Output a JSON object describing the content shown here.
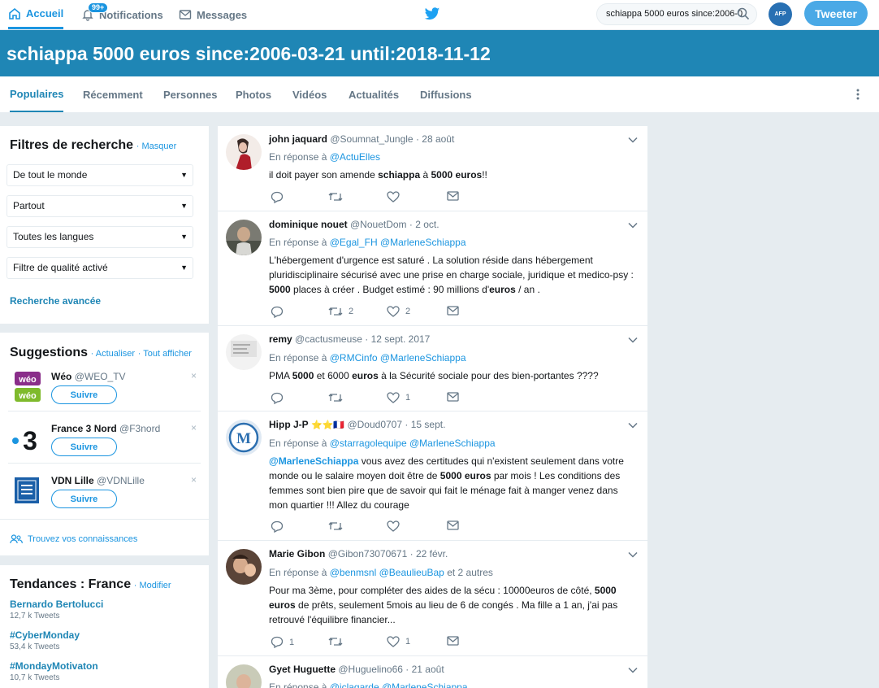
{
  "nav": {
    "home": "Accueil",
    "notifications": "Notifications",
    "notif_badge": "99+",
    "messages": "Messages",
    "search_value": "schiappa 5000 euros since:2006-0",
    "avatar_text": "AFP",
    "tweet_button": "Tweeter"
  },
  "banner": {
    "title": "schiappa 5000 euros since:2006-03-21 until:2018-11-12"
  },
  "tabs": [
    "Populaires",
    "Récemment",
    "Personnes",
    "Photos",
    "Vidéos",
    "Actualités",
    "Diffusions"
  ],
  "filters": {
    "title": "Filtres de recherche",
    "hide": "Masquer",
    "selects": [
      "De tout le monde",
      "Partout",
      "Toutes les langues",
      "Filtre de qualité activé"
    ],
    "advanced": "Recherche avancée"
  },
  "suggestions": {
    "title": "Suggestions",
    "refresh": "Actualiser",
    "show_all": "Tout afficher",
    "follow_label": "Suivre",
    "close": "×",
    "items": [
      {
        "name": "Wéo",
        "handle": "@WEO_TV"
      },
      {
        "name": "France 3 Nord",
        "handle": "@F3nord"
      },
      {
        "name": "VDN Lille",
        "handle": "@VDNLille"
      }
    ],
    "find_people": "Trouvez vos connaissances"
  },
  "trends": {
    "title": "Tendances : France",
    "edit": "Modifier",
    "items": [
      {
        "name": "Bernardo Bertolucci",
        "count": "12,7 k Tweets"
      },
      {
        "name": "#CyberMonday",
        "count": "53,4 k Tweets"
      },
      {
        "name": "#MondayMotivaton",
        "count": "10,7 k Tweets"
      }
    ]
  },
  "tweets": [
    {
      "name": "john jaquard",
      "handle": "@Soumnat_Jungle",
      "sep": "·",
      "date": "28 août",
      "reply_prefix": "En réponse à",
      "reply_to": "@ActuElles",
      "body": [
        "il doit payer son amende ",
        "schiappa",
        " à ",
        "5000",
        " ",
        "euros",
        "!!"
      ],
      "retweets": "",
      "likes": ""
    },
    {
      "name": "dominique nouet",
      "handle": "@NouetDom",
      "sep": "·",
      "date": "2 oct.",
      "reply_prefix": "En réponse à",
      "reply_to": "@Egal_FH @MarleneSchiappa",
      "body_1": "L'hébergement d'urgence est saturé . La solution réside dans hébergement pluridisciplinaire sécurisé avec une prise en charge sociale, juridique et medico-psy : ",
      "body_b1": "5000",
      "body_2": " places à créer . Budget estimé : 90 millions d'",
      "body_b2": "euros",
      "body_3": " / an .",
      "retweets": "2",
      "likes": "2"
    },
    {
      "name": "remy",
      "handle": "@cactusmeuse",
      "sep": "·",
      "date": "12 sept. 2017",
      "reply_prefix": "En réponse à",
      "reply_to": "@RMCinfo @MarleneSchiappa",
      "body_1": "PMA ",
      "body_b1": "5000",
      "body_2": " et 6000 ",
      "body_b2": "euros",
      "body_3": " à la Sécurité sociale pour des bien-portantes ????",
      "retweets": "",
      "likes": "1"
    },
    {
      "name": "Hipp J-P",
      "emoji": "⭐⭐🇫🇷",
      "handle": "@Doud0707",
      "sep": "·",
      "date": "15 sept.",
      "reply_prefix": "En réponse à",
      "reply_to": "@starragolequipe @MarleneSchiappa",
      "body_m": "@MarleneSchiappa",
      "body_1": " vous avez des certitudes qui n'existent seulement dans votre monde ou le salaire moyen doit être de ",
      "body_b1": "5000 euros",
      "body_2": " par mois ! Les conditions des femmes sont bien pire que de savoir qui fait le ménage fait à manger venez dans mon quartier !!! Allez du courage",
      "retweets": "",
      "likes": ""
    },
    {
      "name": "Marie Gibon",
      "handle": "@Gibon73070671",
      "sep": "·",
      "date": "22 févr.",
      "reply_prefix": "En réponse à",
      "reply_to": "@benmsnl @BeaulieuBap",
      "reply_suffix": "et 2 autres",
      "body_1": "Pour ma 3ème, pour compléter des aides de la sécu : 10000euros de côté, ",
      "body_b1": "5000 euros",
      "body_2": " de prêts, seulement 5mois au lieu de 6 de congés . Ma fille a 1 an, j'ai pas retrouvé l'équilibre financier...",
      "replies": "1",
      "retweets": "",
      "likes": "1"
    },
    {
      "name": "Gyet Huguette",
      "handle": "@Huguelino66",
      "sep": "·",
      "date": "21 août",
      "reply_prefix": "En réponse à",
      "reply_to": "@jclagarde @MarleneSchiappa"
    }
  ],
  "colors": {
    "accent": "#1b95e0",
    "banner": "#1f86b5",
    "background": "#e6ecf0"
  }
}
